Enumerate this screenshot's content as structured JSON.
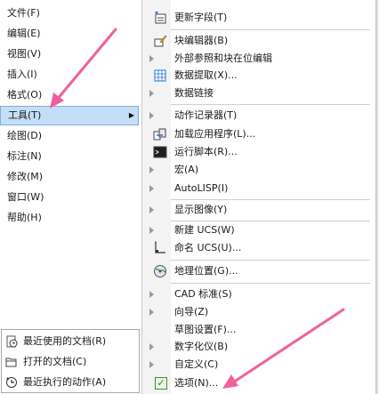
{
  "main_menu": {
    "items": [
      {
        "label": "文件(F)"
      },
      {
        "label": "编辑(E)"
      },
      {
        "label": "视图(V)"
      },
      {
        "label": "插入(I)"
      },
      {
        "label": "格式(O)"
      },
      {
        "label": "工具(T)"
      },
      {
        "label": "绘图(D)"
      },
      {
        "label": "标注(N)"
      },
      {
        "label": "修改(M)"
      },
      {
        "label": "窗口(W)"
      },
      {
        "label": "帮助(H)"
      }
    ],
    "submenu_arrow": "▶"
  },
  "recent_panel": {
    "items": [
      {
        "label": "最近使用的文档(R)",
        "icon": "recent-documents-icon"
      },
      {
        "label": "打开的文档(C)",
        "icon": "open-documents-icon"
      },
      {
        "label": "最近执行的动作(A)",
        "icon": "recent-actions-icon"
      }
    ]
  },
  "tools_submenu": {
    "items": [
      {
        "label": "更新字段(T)",
        "icon": "update-field-icon"
      },
      {
        "label": "块编辑器(B)",
        "icon": "block-editor-icon"
      },
      {
        "label": "外部参照和块在位编辑",
        "icon": "submenu-triangle"
      },
      {
        "label": "数据提取(X)...",
        "icon": "data-extraction-icon"
      },
      {
        "label": "数据链接",
        "icon": "submenu-triangle"
      },
      {
        "label": "动作记录器(T)",
        "icon": "submenu-triangle"
      },
      {
        "label": "加载应用程序(L)...",
        "icon": "load-application-icon"
      },
      {
        "label": "运行脚本(R)...",
        "icon": "run-script-icon"
      },
      {
        "label": "宏(A)",
        "icon": "submenu-triangle"
      },
      {
        "label": "AutoLISP(I)",
        "icon": "submenu-triangle"
      },
      {
        "label": "显示图像(Y)",
        "icon": "submenu-triangle"
      },
      {
        "label": "新建 UCS(W)",
        "icon": "submenu-triangle"
      },
      {
        "label": "命名 UCS(U)...",
        "icon": "named-ucs-icon"
      },
      {
        "label": "地理位置(G)...",
        "icon": "geolocation-icon"
      },
      {
        "label": "CAD 标准(S)",
        "icon": "submenu-triangle"
      },
      {
        "label": "向导(Z)",
        "icon": "submenu-triangle"
      },
      {
        "label": "草图设置(F)...",
        "icon": "none"
      },
      {
        "label": "数字化仪(B)",
        "icon": "submenu-triangle"
      },
      {
        "label": "自定义(C)",
        "icon": "submenu-triangle"
      },
      {
        "label": "选项(N)...",
        "icon": "options-check-icon"
      }
    ]
  },
  "colors": {
    "highlight": "#c5def7",
    "arrow": "#f0609c"
  }
}
